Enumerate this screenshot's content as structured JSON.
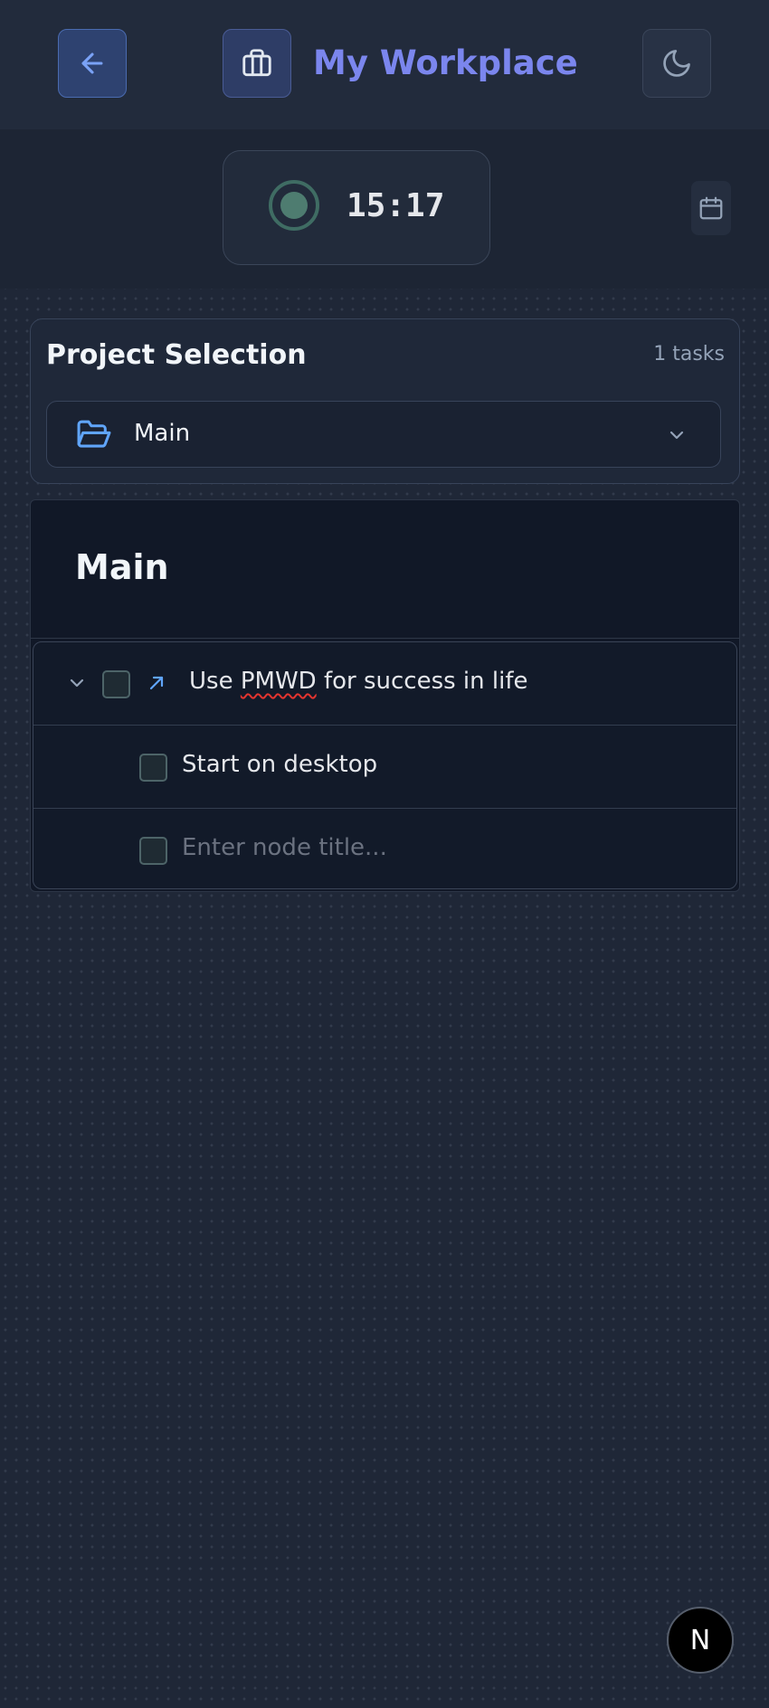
{
  "header": {
    "title": "My Workplace",
    "back_icon": "arrow-left-icon",
    "workplace_icon": "briefcase-icon",
    "theme_icon": "moon-icon"
  },
  "timer": {
    "time": "15:17",
    "status_icon": "record-indicator-icon",
    "calendar_icon": "calendar-icon"
  },
  "project_selection": {
    "title": "Project Selection",
    "count": "1 tasks",
    "selected_project": "Main",
    "folder_icon": "folder-open-icon",
    "dropdown_icon": "chevron-down-icon"
  },
  "tree": {
    "title": "Main",
    "rows": [
      {
        "title_pre": "Use ",
        "title_misspelled": "PMWD",
        "title_post": " for success in life",
        "expanded": true,
        "checked": false
      },
      {
        "title": "Start on desktop",
        "checked": false
      }
    ],
    "new_node_placeholder": "Enter node title..."
  },
  "badge": {
    "letter": "N"
  },
  "colors": {
    "accent": "#7b86ee",
    "background": "#1f2737",
    "panel": "#111827",
    "link_arrow": "#60a5fa",
    "timer_indicator": "#4e7c70"
  }
}
